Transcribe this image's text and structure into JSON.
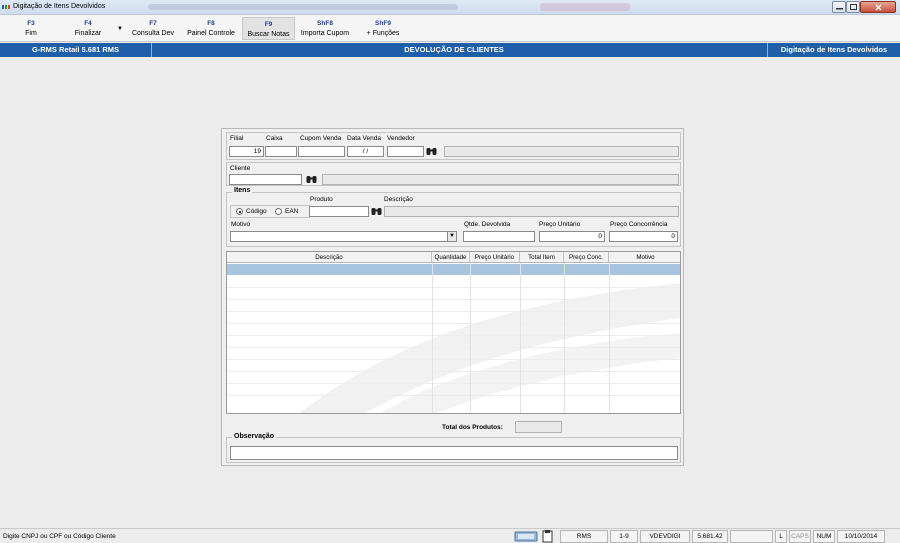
{
  "window": {
    "title": "Digitação de Itens Devolvidos"
  },
  "toolbar": {
    "buttons": [
      {
        "key": "F3",
        "label": "Fim"
      },
      {
        "key": "F4",
        "label": "Finalizar"
      },
      {
        "key": "F7",
        "label": "Consulta Dev"
      },
      {
        "key": "F8",
        "label": "Painel Controle"
      },
      {
        "key": "F9",
        "label": "Buscar Notas"
      },
      {
        "key": "ShF8",
        "label": "Importa Cupom"
      },
      {
        "key": "ShF9",
        "label": "+ Funções"
      }
    ]
  },
  "header": {
    "left": "G-RMS Retail 5.681 RMS",
    "center": "DEVOLUÇÃO DE CLIENTES",
    "right": "Digitação de Itens Devolvidos"
  },
  "form": {
    "filial_label": "Filial",
    "filial_value": "19",
    "caixa_label": "Caixa",
    "cupom_label": "Cupom Venda",
    "data_venda_label": "Data Venda",
    "data_venda_value": "/ /",
    "vendedor_label": "Vendedor",
    "cliente_label": "Cliente",
    "itens_legend": "Itens",
    "produto_label": "Produto",
    "descricao_label": "Descrição",
    "codigo_label": "Código",
    "ean_label": "EAN",
    "motivo_label": "Motivo",
    "qtde_label": "Qtde. Devolvida",
    "preco_unit_label": "Preço Unitário",
    "preco_unit_value": "0",
    "preco_conc_label": "Preço Concorrência",
    "preco_conc_value": "0",
    "total_label": "Total dos Produtos:",
    "observacao_label": "Observação"
  },
  "grid": {
    "columns": [
      "Descrição",
      "Quantidade",
      "Preço Unitário",
      "Total Item",
      "Preço Conc.",
      "Motivo"
    ]
  },
  "statusbar": {
    "message": "Digite CNPJ ou CPF ou Código Cliente",
    "system": "RMS",
    "page": "1-9",
    "program": "VDEVDIGI",
    "version": "5.681.42",
    "lock_l": "L",
    "caps": "CAPS",
    "num": "NUM",
    "date": "10/10/2014"
  },
  "colors": {
    "header_blue": "#1f5ea8",
    "selected_row": "#a9c4df"
  }
}
